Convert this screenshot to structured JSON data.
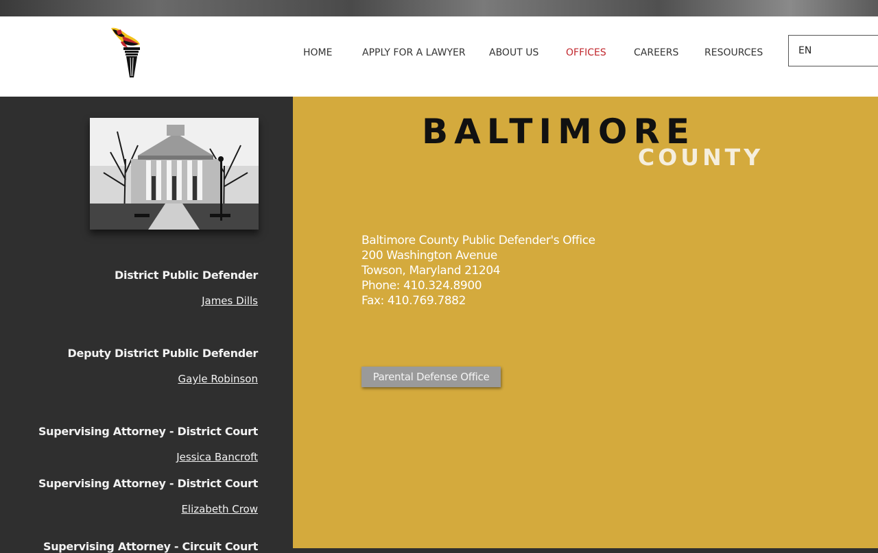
{
  "nav": {
    "items": [
      {
        "label": "HOME",
        "active": false
      },
      {
        "label": "APPLY FOR A LAWYER",
        "active": false
      },
      {
        "label": "ABOUT US",
        "active": false
      },
      {
        "label": "OFFICES",
        "active": true
      },
      {
        "label": "CAREERS",
        "active": false
      },
      {
        "label": "RESOURCES",
        "active": false
      }
    ],
    "language": "EN"
  },
  "colors": {
    "accent_gold": "#d4aa3d",
    "sidebar_dark": "#2f2f2f",
    "nav_active": "#c1272d"
  },
  "logo": {
    "icon": "torch-logo-icon"
  },
  "office": {
    "title_main": "BALTIMORE",
    "title_sub": "COUNTY",
    "address": {
      "name": "Baltimore County Public Defender's Office",
      "street": "200 Washington Avenue",
      "city": "Towson, Maryland 21204",
      "phone": "Phone: 410.324.8900",
      "fax": "Fax: 410.769.7882"
    },
    "button_label": "Parental Defense Office"
  },
  "staff": [
    {
      "role": "District Public Defender",
      "name": "James Dills"
    },
    {
      "role": "Deputy District Public Defender",
      "name": "Gayle Robinson"
    },
    {
      "role": "Supervising Attorney - District Court",
      "name": "Jessica Bancroft"
    },
    {
      "role": "Supervising Attorney - District Court",
      "name": "Elizabeth Crow"
    },
    {
      "role": "Supervising Attorney - Circuit Court",
      "name": ""
    }
  ]
}
